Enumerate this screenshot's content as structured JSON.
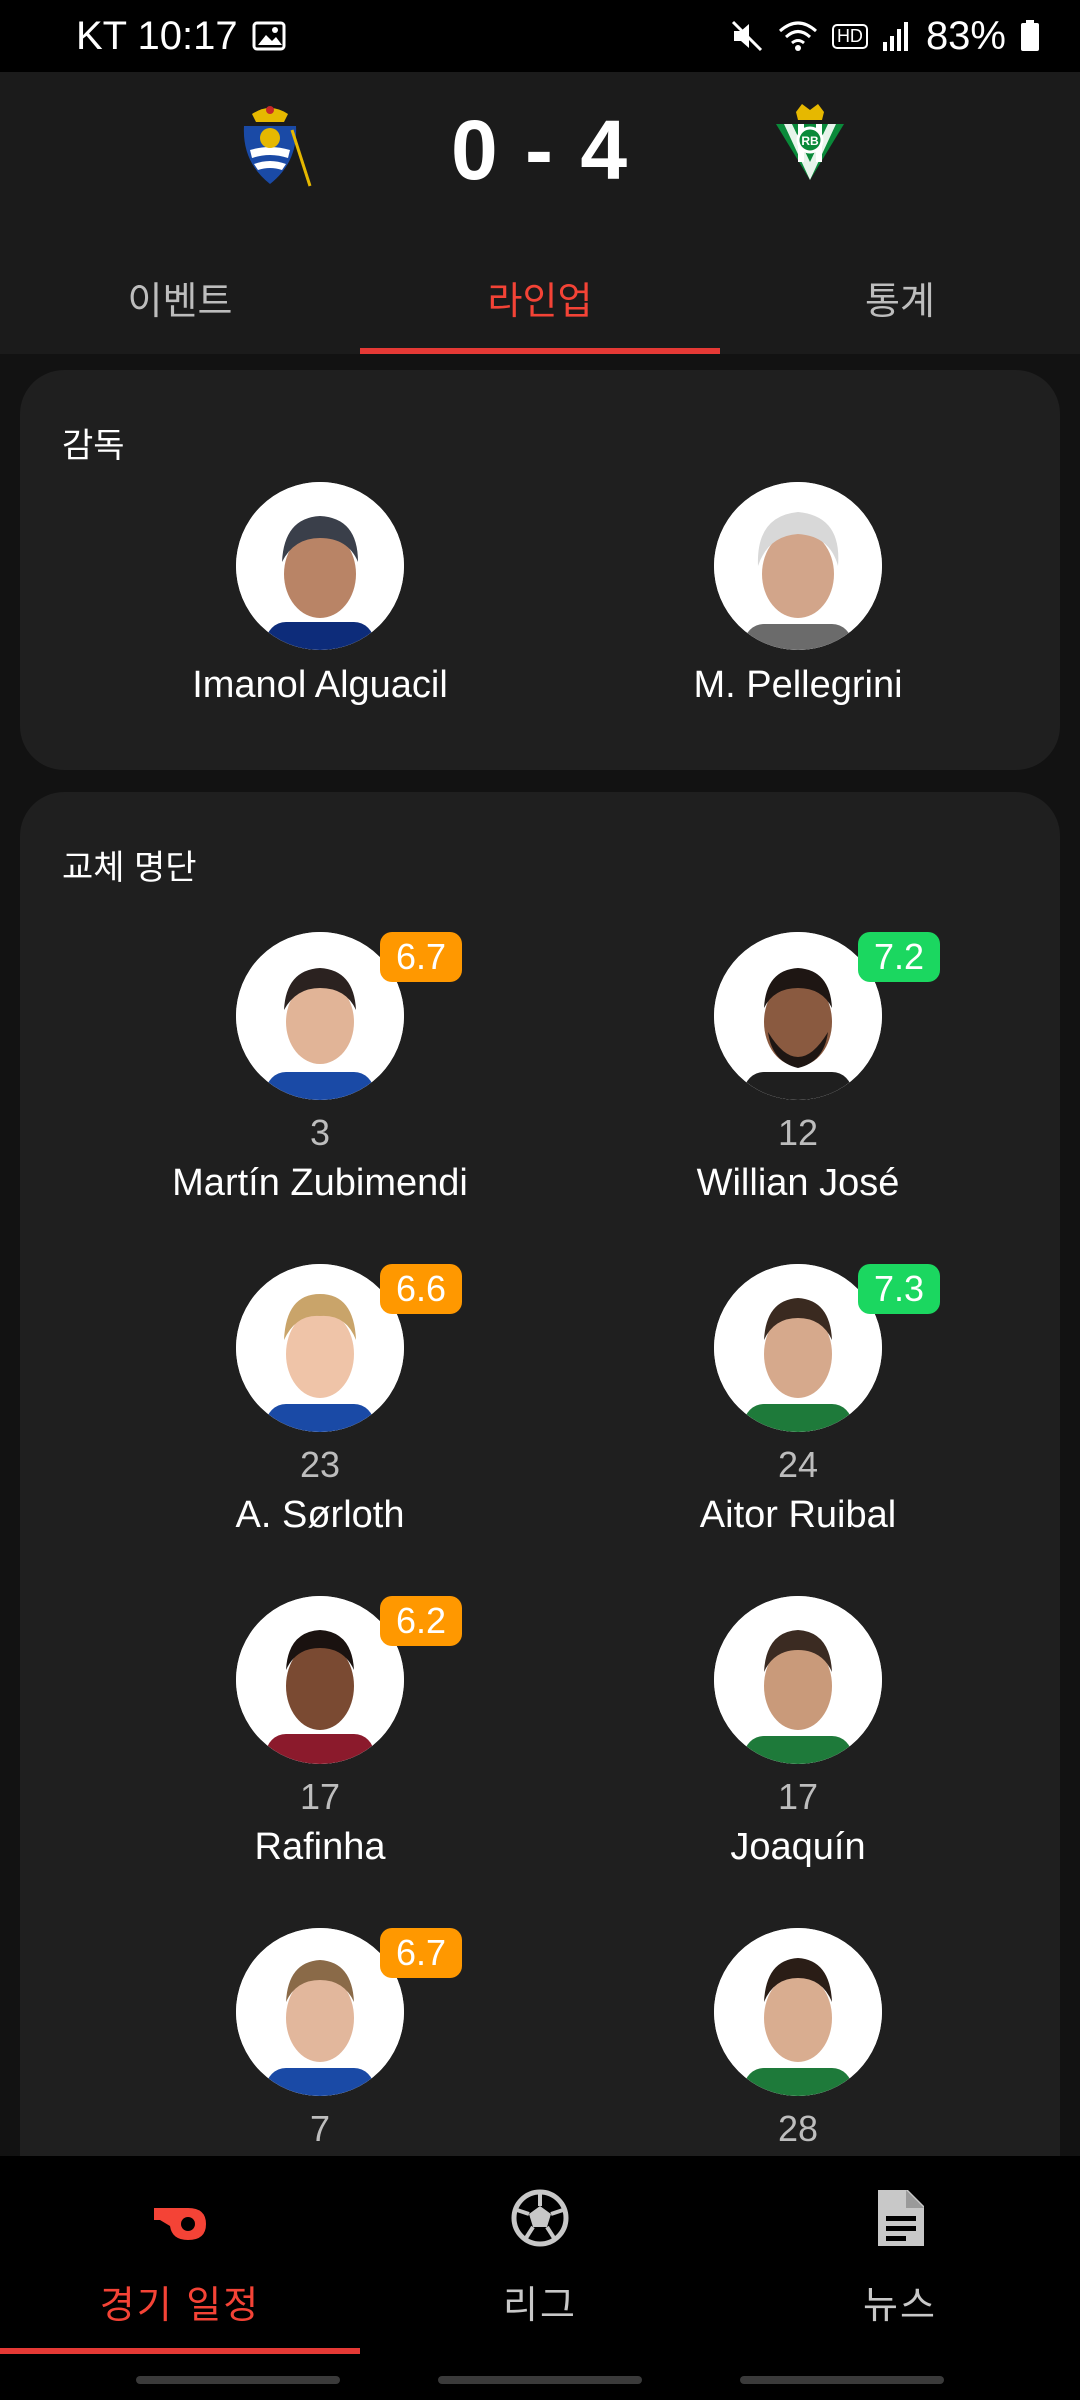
{
  "status_bar": {
    "carrier_time": "KT 10:17",
    "battery": "83%",
    "hd_label": "HD"
  },
  "match": {
    "score": "0 - 4",
    "home_logo_icon": "real-sociedad-crest-icon",
    "away_logo_icon": "real-betis-crest-icon"
  },
  "tabs": [
    {
      "label": "이벤트",
      "active": false
    },
    {
      "label": "라인업",
      "active": true
    },
    {
      "label": "통계",
      "active": false
    }
  ],
  "managers": {
    "title": "감독",
    "home": {
      "name": "Imanol Alguacil"
    },
    "away": {
      "name": "M. Pellegrini"
    }
  },
  "substitutes": {
    "title": "교체 명단",
    "rows": [
      {
        "home": {
          "number": "3",
          "name": "Martín Zubimendi",
          "rating": "6.7",
          "rating_color": "#ff9800"
        },
        "away": {
          "number": "12",
          "name": "Willian José",
          "rating": "7.2",
          "rating_color": "#1bd760"
        }
      },
      {
        "home": {
          "number": "23",
          "name": "A. Sørloth",
          "rating": "6.6",
          "rating_color": "#ff9800"
        },
        "away": {
          "number": "24",
          "name": "Aitor Ruibal",
          "rating": "7.3",
          "rating_color": "#1bd760"
        }
      },
      {
        "home": {
          "number": "17",
          "name": "Rafinha",
          "rating": "6.2",
          "rating_color": "#ff9800"
        },
        "away": {
          "number": "17",
          "name": "Joaquín"
        }
      },
      {
        "home": {
          "number": "7",
          "rating": "6.7",
          "rating_color": "#ff9800"
        },
        "away": {
          "number": "28"
        }
      }
    ]
  },
  "bottom_nav": [
    {
      "label": "경기 일정",
      "icon": "whistle-icon",
      "active": true
    },
    {
      "label": "리그",
      "icon": "soccer-ball-icon",
      "active": false
    },
    {
      "label": "뉴스",
      "icon": "news-document-icon",
      "active": false
    }
  ],
  "colors": {
    "accent": "#f44336",
    "rating_orange": "#ff9800",
    "rating_green": "#1bd760",
    "card_bg": "#1f1f1f"
  }
}
